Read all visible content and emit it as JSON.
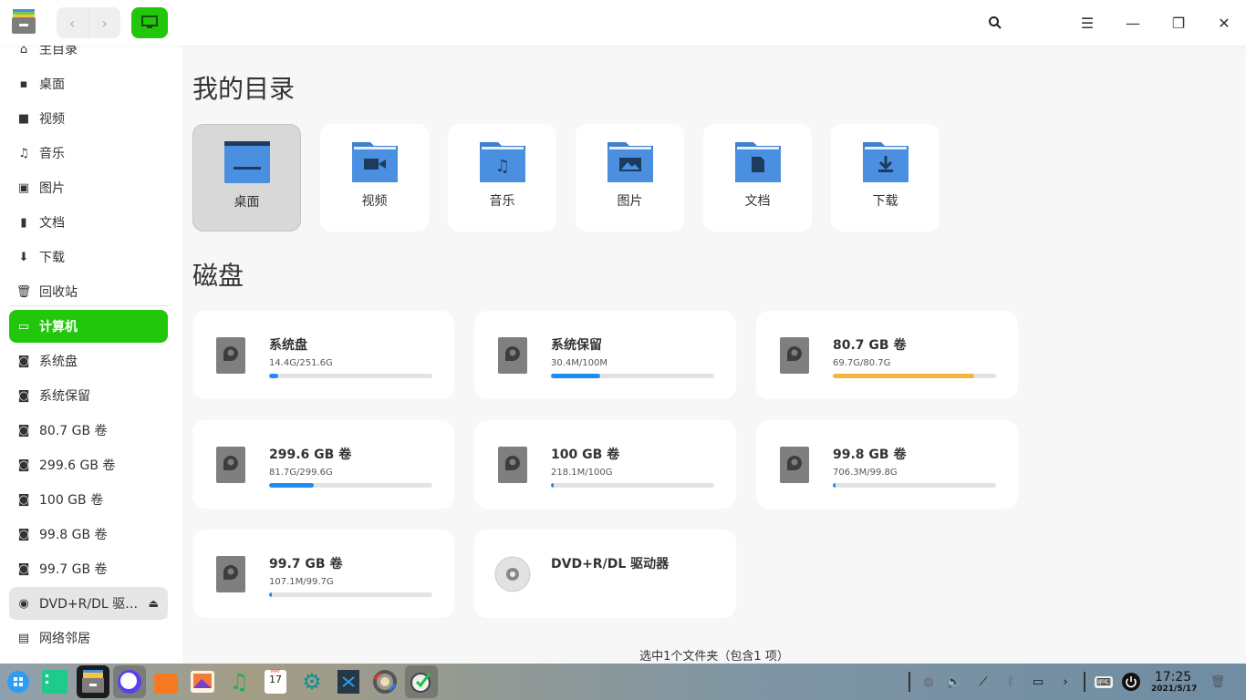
{
  "titlebar": {
    "back": "‹",
    "forward": "›"
  },
  "sidebar": {
    "items": [
      {
        "label": "主目录",
        "icon": "home-icon",
        "glyph": "⌂"
      },
      {
        "label": "桌面",
        "icon": "desktop-icon",
        "glyph": "▪"
      },
      {
        "label": "视频",
        "icon": "video-icon",
        "glyph": "■"
      },
      {
        "label": "音乐",
        "icon": "music-icon",
        "glyph": "♫"
      },
      {
        "label": "图片",
        "icon": "picture-icon",
        "glyph": "▣"
      },
      {
        "label": "文档",
        "icon": "document-icon",
        "glyph": "▮"
      },
      {
        "label": "下载",
        "icon": "download-icon",
        "glyph": "⬇"
      },
      {
        "label": "回收站",
        "icon": "trash-icon",
        "glyph": "🗑"
      },
      {
        "label": "计算机",
        "icon": "computer-icon",
        "glyph": "▭",
        "active": true
      },
      {
        "label": "系统盘",
        "icon": "disk-icon",
        "glyph": "◙"
      },
      {
        "label": "系统保留",
        "icon": "disk-icon",
        "glyph": "◙"
      },
      {
        "label": "80.7 GB 卷",
        "icon": "disk-icon",
        "glyph": "◙"
      },
      {
        "label": "299.6 GB 卷",
        "icon": "disk-icon",
        "glyph": "◙"
      },
      {
        "label": "100 GB 卷",
        "icon": "disk-icon",
        "glyph": "◙"
      },
      {
        "label": "99.8 GB 卷",
        "icon": "disk-icon",
        "glyph": "◙"
      },
      {
        "label": "99.7 GB 卷",
        "icon": "disk-icon",
        "glyph": "◙"
      },
      {
        "label": "DVD+R/DL 驱…",
        "icon": "optical-disc-icon",
        "glyph": "◉",
        "dvd": true
      },
      {
        "label": "网络邻居",
        "icon": "network-icon",
        "glyph": "▤"
      }
    ],
    "eject": "⏏"
  },
  "main": {
    "dirs_title": "我的目录",
    "folders": [
      {
        "label": "桌面",
        "icon": "desktop-folder-icon",
        "selected": true
      },
      {
        "label": "视频",
        "icon": "video-folder-icon"
      },
      {
        "label": "音乐",
        "icon": "music-folder-icon"
      },
      {
        "label": "图片",
        "icon": "picture-folder-icon"
      },
      {
        "label": "文档",
        "icon": "document-folder-icon"
      },
      {
        "label": "下载",
        "icon": "download-folder-icon"
      }
    ],
    "disks_title": "磁盘",
    "disks": [
      {
        "name": "系统盘",
        "size": "14.4G/251.6G",
        "used": 0.057,
        "color": "#1f8bf5"
      },
      {
        "name": "系统保留",
        "size": "30.4M/100M",
        "used": 0.304,
        "color": "#1f8bf5"
      },
      {
        "name": "80.7 GB 卷",
        "size": "69.7G/80.7G",
        "used": 0.864,
        "color": "#f4b63f"
      },
      {
        "name": "299.6 GB 卷",
        "size": "81.7G/299.6G",
        "used": 0.273,
        "color": "#1f8bf5"
      },
      {
        "name": "100 GB 卷",
        "size": "218.1M/100G",
        "used": 0.002,
        "color": "#1f8bf5"
      },
      {
        "name": "99.8 GB 卷",
        "size": "706.3M/99.8G",
        "used": 0.007,
        "color": "#1f8bf5"
      },
      {
        "name": "99.7 GB 卷",
        "size": "107.1M/99.7G",
        "used": 0.001,
        "color": "#1f8bf5"
      },
      {
        "name": "DVD+R/DL 驱动器",
        "optical": true
      }
    ],
    "status": "选中1个文件夹（包含1 项）"
  },
  "taskbar": {
    "time": "17:25",
    "date": "2021/5/17",
    "calendar_month": "MAY",
    "calendar_day": "17"
  }
}
